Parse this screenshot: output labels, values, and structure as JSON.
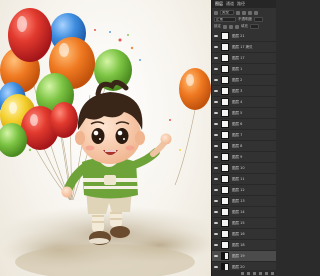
{
  "panel": {
    "tabs": [
      "图层",
      "通道",
      "路径"
    ],
    "kind_label": "类型",
    "blend_mode": "正常",
    "opacity_label": "不透明度",
    "lock_label": "锁定",
    "fill_label": "填充"
  },
  "layers": [
    {
      "name": "图层 21",
      "selected": false
    },
    {
      "name": "图层 17 拷贝",
      "selected": false
    },
    {
      "name": "图层 17",
      "selected": false
    },
    {
      "name": "图层 1",
      "selected": false
    },
    {
      "name": "图层 2",
      "selected": false
    },
    {
      "name": "图层 3",
      "selected": false
    },
    {
      "name": "图层 4",
      "selected": false
    },
    {
      "name": "图层 5",
      "selected": false
    },
    {
      "name": "图层 6",
      "selected": false
    },
    {
      "name": "图层 7",
      "selected": false
    },
    {
      "name": "图层 8",
      "selected": false
    },
    {
      "name": "图层 9",
      "selected": false
    },
    {
      "name": "图层 10",
      "selected": false
    },
    {
      "name": "图层 11",
      "selected": false
    },
    {
      "name": "图层 12",
      "selected": false
    },
    {
      "name": "图层 13",
      "selected": false
    },
    {
      "name": "图层 14",
      "selected": false
    },
    {
      "name": "图层 15",
      "selected": false
    },
    {
      "name": "图层 16",
      "selected": false
    },
    {
      "name": "图层 18",
      "selected": false
    },
    {
      "name": "图层 19",
      "selected": true
    },
    {
      "name": "图层 20",
      "selected": false
    }
  ],
  "colors": {
    "panel_bg": "#323232",
    "balloon_red": "#d92b2b",
    "balloon_blue": "#3f8ee0",
    "balloon_orange": "#f07a22",
    "balloon_green": "#7cc443",
    "balloon_yellow": "#f4cf2c",
    "shirt_green": "#6ea33a"
  }
}
